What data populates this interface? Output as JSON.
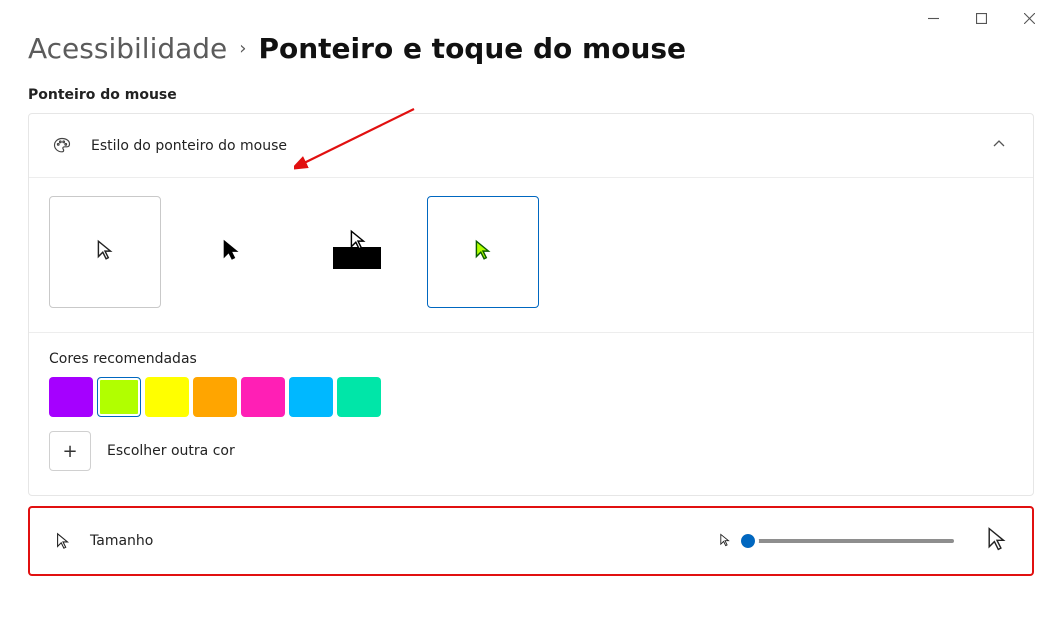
{
  "breadcrumb": {
    "parent": "Acessibilidade",
    "current": "Ponteiro e toque do mouse"
  },
  "sectionLabel": "Ponteiro do mouse",
  "styleCard": {
    "title": "Estilo do ponteiro do mouse",
    "options": [
      {
        "id": "white",
        "iconName": "cursor-white-icon"
      },
      {
        "id": "black",
        "iconName": "cursor-black-icon"
      },
      {
        "id": "inverted",
        "iconName": "cursor-inverted-icon"
      },
      {
        "id": "color",
        "iconName": "cursor-color-icon"
      }
    ],
    "selectedIndex": 3
  },
  "colors": {
    "title": "Cores recomendadas",
    "swatches": [
      "#a500ff",
      "#b1ff00",
      "#ffff00",
      "#ffa500",
      "#ff1fb5",
      "#00b8ff",
      "#00e6a8"
    ],
    "selectedIndex": 1,
    "chooseLabel": "Escolher outra cor"
  },
  "size": {
    "label": "Tamanho",
    "valuePercent": 2
  },
  "accent": "#0067c0",
  "annotationColor": "#e11010"
}
